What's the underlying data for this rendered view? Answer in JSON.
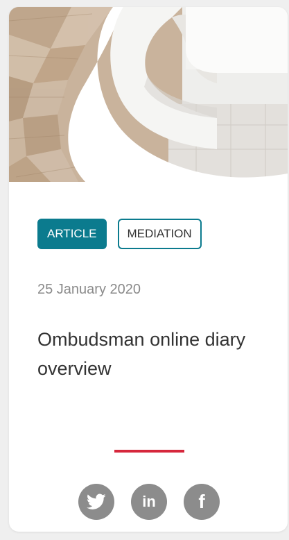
{
  "card": {
    "image_alt": "white spiral staircase with wooden steps",
    "tags": [
      {
        "label": "ARTICLE",
        "style": "filled"
      },
      {
        "label": "MEDIATION",
        "style": "outline"
      }
    ],
    "date": "25 January 2020",
    "title": "Ombudsman online diary overview",
    "social": [
      {
        "icon": "twitter-icon",
        "glyph": "🐦"
      },
      {
        "icon": "linkedin-icon",
        "glyph": "in"
      },
      {
        "icon": "facebook-icon",
        "glyph": "f"
      }
    ]
  },
  "colors": {
    "accent_teal": "#0b7b8e",
    "divider_red": "#d6273c",
    "icon_gray": "#8c8c8c",
    "date_gray": "#8a8a8a",
    "title_text": "#333333"
  }
}
